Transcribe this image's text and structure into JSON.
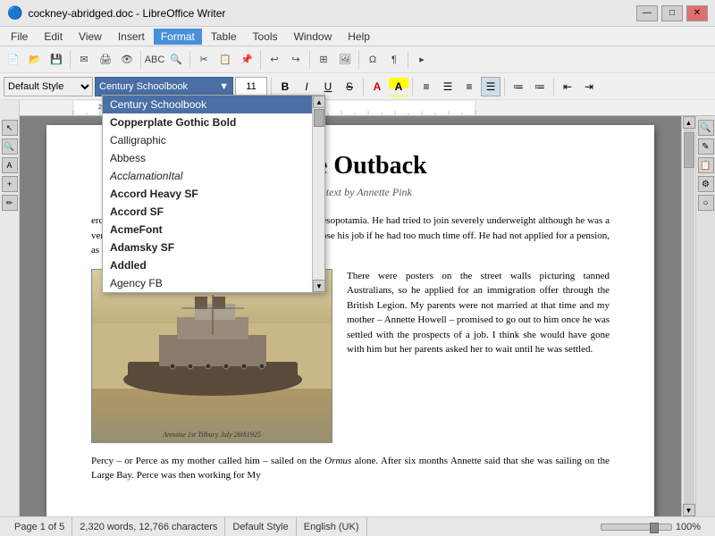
{
  "titlebar": {
    "title": "cockney-abridged.doc - LibreOffice Writer",
    "icon": "🔵",
    "controls": [
      "—",
      "□",
      "✕"
    ]
  },
  "menubar": {
    "items": [
      "File",
      "Edit",
      "View",
      "Insert",
      "Format",
      "Table",
      "Tools",
      "Window",
      "Help"
    ]
  },
  "toolbar1": {
    "buttons": [
      "new",
      "open",
      "save",
      "email",
      "print",
      "preview",
      "spellcheck",
      "find",
      "paste",
      "copy",
      "cut",
      "undo",
      "redo"
    ]
  },
  "toolbar2": {
    "style": "Default Style",
    "font": "Century Schoolbook",
    "size": "11",
    "format_buttons": [
      "B",
      "I",
      "U",
      "S",
      "A"
    ]
  },
  "font_dropdown": {
    "selected": "Century Schoolbook",
    "items": [
      {
        "name": "Century Schoolbook",
        "style": "normal"
      },
      {
        "name": "Copperplate Gothic Bold",
        "style": "bold"
      },
      {
        "name": "Calligraphic",
        "style": "normal"
      },
      {
        "name": "Abbess",
        "style": "normal"
      },
      {
        "name": "AcclamationItal",
        "style": "italic"
      },
      {
        "name": "Accord Heavy SF",
        "style": "bold"
      },
      {
        "name": "Accord SF",
        "style": "bold"
      },
      {
        "name": "AcmeFont",
        "style": "bold"
      },
      {
        "name": "Adamsky SF",
        "style": "bold"
      },
      {
        "name": "Addled",
        "style": "bold"
      },
      {
        "name": "Agency FB",
        "style": "normal"
      }
    ]
  },
  "document": {
    "title": "n the Outback",
    "subtitle": "original text by Annette Pink",
    "paragraph1": "ercy Pink, was demobilized and every winter serving in Mesopotamia.  He had tried to join severely underweight although he was a very d with a carpenter on a new estate at eared he would lose his job if he had too much time off.  He had not applied for a pension, as only fit men were employed.",
    "paragraph2": "There were posters on the street walls picturing tanned Australians, so he applied for an immigration offer through the British Legion. My parents were not married at that time and my mother – Annette Howell – promised to go out to him once he was settled with the prospects of a job. I think she would have gone with him but her parents asked her to wait until he was settled.",
    "paragraph3": "Percy – or Perce as my mother called him – sailed on the Ormus alone. After six months Annette said that she was sailing on the Large Bay. Perce was then working for My",
    "img_caption": "Annaise 1st Tilbury July 26th1925"
  },
  "statusbar": {
    "page": "Page 1 of 5",
    "words": "2,320 words, 12,766 characters",
    "style": "Default Style",
    "language": "English (UK)",
    "zoom": "100%"
  },
  "colors": {
    "toolbar_bg": "#f0f0f0",
    "font_combo_bg": "#4a6fa5",
    "selection_bg": "#4a6fa5",
    "document_bg": "white"
  }
}
